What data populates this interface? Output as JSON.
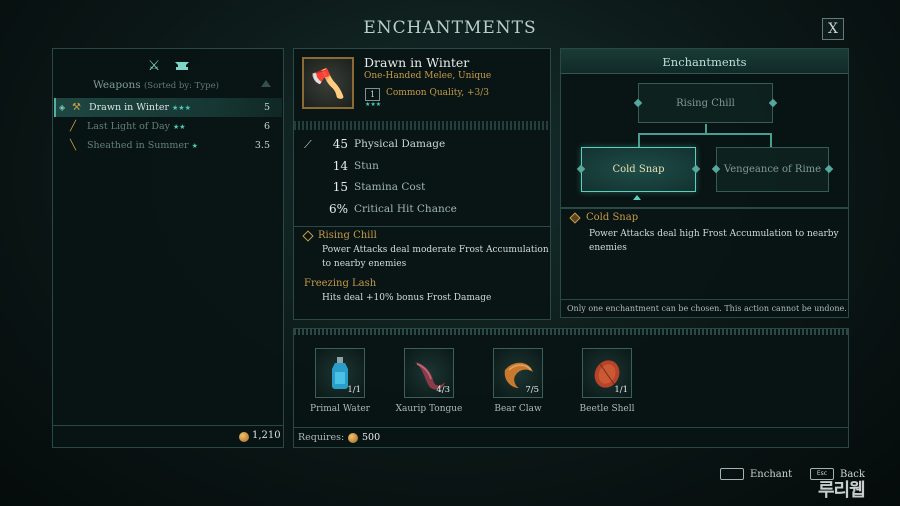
{
  "window": {
    "title": "ENCHANTMENTS",
    "close_label": "X"
  },
  "weapons_panel": {
    "header": "Weapons",
    "sort_note": "(Sorted by: Type)",
    "filter_icons": [
      "crossed-swords-icon",
      "anvil-icon"
    ],
    "items": [
      {
        "name": "Drawn in Winter",
        "stars": "★★★",
        "value": "5",
        "selected": true,
        "icon": "axe-icon"
      },
      {
        "name": "Last Light of Day",
        "stars": "★★",
        "value": "6",
        "selected": false,
        "icon": "sword-icon"
      },
      {
        "name": "Sheathed in Summer",
        "stars": "★",
        "value": "3.5",
        "selected": false,
        "icon": "sword-icon"
      }
    ],
    "gold": "1,210"
  },
  "weapon": {
    "name": "Drawn in Winter",
    "subtitle": "One-Handed Melee, Unique",
    "quality_level": "1",
    "quality_stars": "★★★",
    "quality_text": "Common Quality, +3/3",
    "stats": [
      {
        "value": "45",
        "label": "Physical Damage",
        "icon": "slash-icon"
      },
      {
        "value": "14",
        "label": "Stun",
        "icon": ""
      },
      {
        "value": "15",
        "label": "Stamina Cost",
        "icon": ""
      },
      {
        "value": "6%",
        "label": "Critical Hit Chance",
        "icon": ""
      }
    ],
    "enchantments": [
      {
        "name": "Rising Chill",
        "desc": "Power Attacks deal moderate Frost Accumulation to nearby enemies"
      },
      {
        "name": "Freezing Lash",
        "desc": "Hits deal +10% bonus Frost Damage"
      }
    ]
  },
  "enchant_tree": {
    "title": "Enchantments",
    "root": "Rising Chill",
    "left": "Cold Snap",
    "right": "Vengeance of Rime",
    "selected_name": "Cold Snap",
    "selected_desc": "Power Attacks deal high Frost Accumulation to nearby enemies",
    "note": "Only one enchantment can be chosen. This action cannot be undone."
  },
  "materials": {
    "items": [
      {
        "name": "Primal Water",
        "count": "1/1",
        "icon": "bottle-icon"
      },
      {
        "name": "Xaurip Tongue",
        "count": "4/3",
        "icon": "tongue-icon"
      },
      {
        "name": "Bear Claw",
        "count": "7/5",
        "icon": "claw-icon"
      },
      {
        "name": "Beetle Shell",
        "count": "1/1",
        "icon": "shell-icon"
      }
    ],
    "requires_label": "Requires:",
    "requires_value": "500"
  },
  "hints": {
    "enchant": "Enchant",
    "back": "Back",
    "enchant_key": "",
    "back_key": "Esc"
  },
  "watermark": "루리웹",
  "colors": {
    "accent": "#4fc7b4",
    "gold": "#c59a4a",
    "panel_border": "#2a4946"
  }
}
